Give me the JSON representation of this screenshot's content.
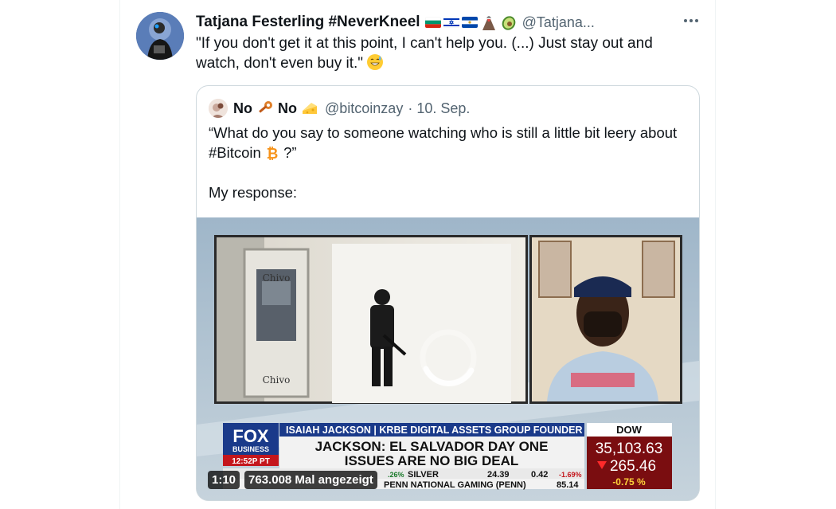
{
  "tweet": {
    "display_name": "Tatjana Festerling #NeverKneel",
    "handle": "@Tatjana...",
    "text": "\"If you don't get it at this point, I can't help you. (...) Just stay out and watch, don't even buy it.\"",
    "emoji_icon": "grinning-sweat-emoji",
    "flags": [
      "bulgaria-flag",
      "israel-flag",
      "el-salvador-flag",
      "volcano-emoji",
      "avocado-emoji"
    ],
    "more_icon": "more-dots-icon"
  },
  "quoted_tweet": {
    "name_part1": "No",
    "name_part2": "No",
    "name_emojis": [
      "key-emoji",
      "cheese-emoji"
    ],
    "handle": "@bitcoinzay",
    "date": "· 10. Sep.",
    "text_line1": "“What do you say to someone watching who is still a little bit leery about #Bitcoin",
    "text_line1_end": "?”",
    "text_line2": "My response:",
    "bitcoin_icon": "bitcoin-icon"
  },
  "video": {
    "duration": "1:10",
    "views": "763.008 Mal angezeigt",
    "lower_third": {
      "network_line1": "FOX",
      "network_line2": "BUSINESS",
      "time": "12:52P PT",
      "name_bar": "ISAIAH JACKSON | KRBE DIGITAL ASSETS GROUP FOUNDER",
      "headline_line1": "JACKSON: EL SALVADOR DAY ONE",
      "headline_line2": "ISSUES ARE NO BIG DEAL",
      "ticker_left": "SILVER",
      "ticker_left_value": "24.39",
      "ticker_left_change": "0.42",
      "ticker_left_pct": "-1.69%",
      "ticker_left_prev": ".26%",
      "ticker_bottom": "PENN NATIONAL GAMING (PENN)",
      "ticker_bottom_value": "85.14",
      "index_name": "DOW",
      "index_value": "35,103.63",
      "index_change": "265.46",
      "index_pct": "-0.75 %"
    },
    "left_scene_sign1": "Chivo",
    "left_scene_sign2": "Chivo",
    "loading_icon": "loading-spinner-icon",
    "colors": {
      "fox_blue": "#1a3a8a",
      "dow_red": "#c4161c",
      "headline_bg": "#f2f2f2"
    }
  }
}
